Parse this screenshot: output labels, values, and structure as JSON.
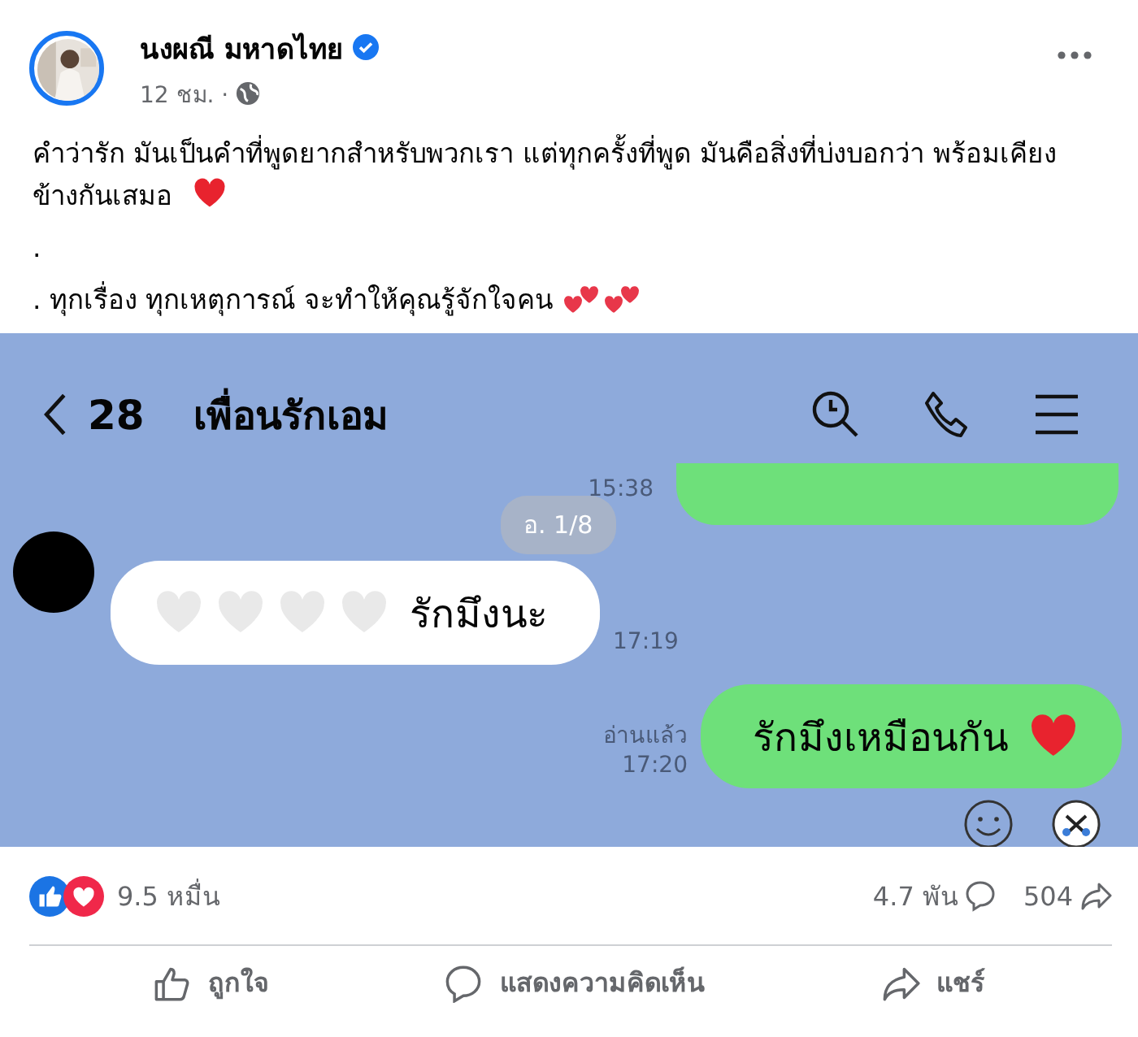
{
  "post": {
    "author": "นงผณี มหาดไทย",
    "verified": true,
    "time": "12 ชม. ·",
    "paragraphs": [
      {
        "text": "คำว่ารัก มันเป็นคำที่พูดยากสำหรับพวกเรา แต่ทุกครั้งที่พูด มันคือสิ่งที่บ่งบอกว่า พร้อมเคียงข้างกันเสมอ",
        "hearts": [
          {
            "color": "#e8232e"
          }
        ]
      },
      {
        "text": "."
      },
      {
        "text": ". ทุกเรื่อง ทุกเหตุการณ์ จะทำให้คุณรู้จักใจคน",
        "hearts": [
          {
            "color": "#e8374a"
          },
          {
            "color": "#e8374a"
          },
          {
            "color": "#e8374a"
          },
          {
            "color": "#e8374a"
          }
        ]
      }
    ]
  },
  "chat": {
    "unread": "28",
    "title": "เพื่อนรักเอม",
    "date_pill": "อ. 1/8",
    "messages": [
      {
        "kind": "outgoing-clipped",
        "time": "15:38"
      },
      {
        "kind": "incoming",
        "hearts_before": [
          {
            "color": "#e9e9e9"
          },
          {
            "color": "#e9e9e9"
          },
          {
            "color": "#e9e9e9"
          },
          {
            "color": "#e9e9e9"
          }
        ],
        "text": "รักมึงนะ",
        "time": "17:19"
      },
      {
        "kind": "outgoing",
        "text": "รักมึงเหมือนกัน",
        "hearts_after": [
          {
            "color": "#e8232e"
          }
        ],
        "read": "อ่านแล้ว",
        "time": "17:20"
      }
    ]
  },
  "stats": {
    "reactions": "9.5 หมื่น",
    "comments": "4.7 พัน",
    "shares": "504"
  },
  "actions": [
    {
      "kind": "like",
      "label": "ถูกใจ"
    },
    {
      "kind": "comment",
      "label": "แสดงความคิดเห็น"
    },
    {
      "kind": "share",
      "label": "แชร์"
    }
  ]
}
